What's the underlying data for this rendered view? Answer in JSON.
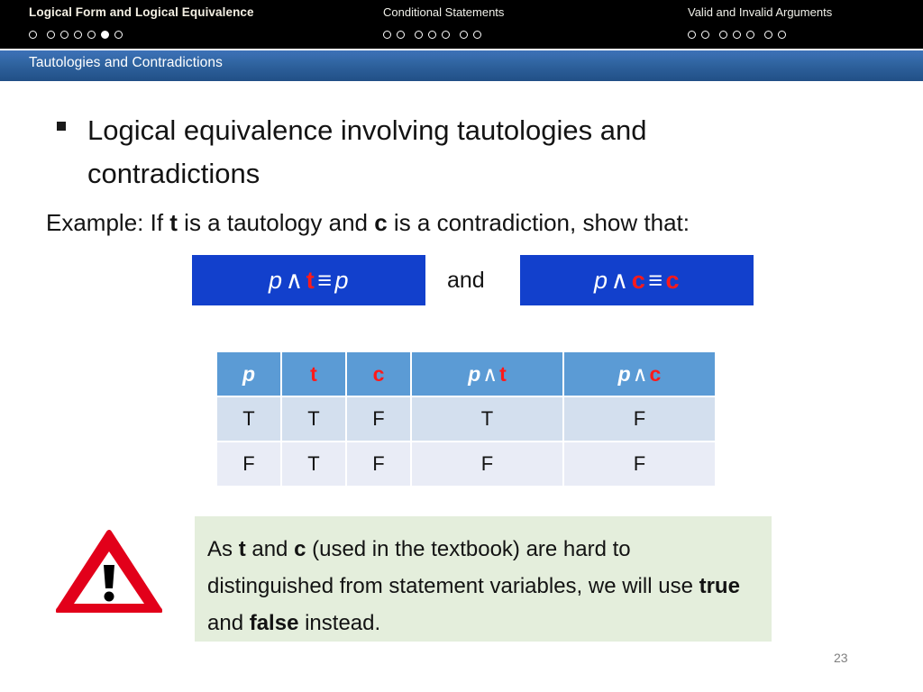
{
  "topbar": {
    "groups": [
      {
        "title": "Logical Form and Logical Equivalence",
        "dots": [
          {
            "state": "empty",
            "gap_after": true
          },
          {
            "state": "empty",
            "gap_after": false
          },
          {
            "state": "empty",
            "gap_after": false
          },
          {
            "state": "empty",
            "gap_after": false
          },
          {
            "state": "empty",
            "gap_after": false
          },
          {
            "state": "filled",
            "gap_after": false
          },
          {
            "state": "empty",
            "gap_after": false
          }
        ]
      },
      {
        "title": "Conditional Statements",
        "dots": [
          {
            "state": "empty",
            "gap_after": false
          },
          {
            "state": "empty",
            "gap_after": true
          },
          {
            "state": "empty",
            "gap_after": false
          },
          {
            "state": "empty",
            "gap_after": false
          },
          {
            "state": "empty",
            "gap_after": true
          },
          {
            "state": "empty",
            "gap_after": false
          },
          {
            "state": "empty",
            "gap_after": false
          }
        ]
      },
      {
        "title": "Valid and Invalid Arguments",
        "dots": [
          {
            "state": "empty",
            "gap_after": false
          },
          {
            "state": "empty",
            "gap_after": true
          },
          {
            "state": "empty",
            "gap_after": false
          },
          {
            "state": "empty",
            "gap_after": false
          },
          {
            "state": "empty",
            "gap_after": true
          },
          {
            "state": "empty",
            "gap_after": false
          },
          {
            "state": "empty",
            "gap_after": false
          }
        ]
      }
    ]
  },
  "section": {
    "label": "Tautologies and Contradictions"
  },
  "slide": {
    "bullet": "Logical equivalence involving tautologies and contradictions",
    "example_prefix": "Example: If ",
    "example_t": "t",
    "example_mid": " is a tautology and ",
    "example_c": "c",
    "example_suffix": " is a contradiction, show that:",
    "and_word": "and",
    "page_number": "23"
  },
  "formulas": [
    {
      "var1": "p",
      "op1": "∧",
      "const": "t",
      "op2": "≡",
      "var2": "p",
      "background": "#1240cc"
    },
    {
      "var1": "p",
      "op1": "∧",
      "const": "c",
      "op2": "≡",
      "var2": "c",
      "background": "#1240cc"
    }
  ],
  "truth_table": {
    "headers": [
      {
        "var": "p",
        "op": "",
        "const": ""
      },
      {
        "var": "",
        "op": "",
        "const": "t"
      },
      {
        "var": "",
        "op": "",
        "const": "c"
      },
      {
        "var": "p",
        "op": "∧",
        "const": "t"
      },
      {
        "var": "p",
        "op": "∧",
        "const": "c"
      }
    ],
    "rows": [
      [
        "T",
        "T",
        "F",
        "T",
        "F"
      ],
      [
        "F",
        "T",
        "F",
        "F",
        "F"
      ]
    ],
    "header_bg": "#5b9bd5",
    "row_bg_a": "#d3dfee",
    "row_bg_b": "#e9ecf6"
  },
  "note": {
    "part1": "As ",
    "bold1": "t",
    "part2": " and ",
    "bold2": "c",
    "part3": " (used in the textbook) are hard to distinguished from statement variables, we will use ",
    "bold3": "true",
    "part4": " and ",
    "bold4": "false",
    "part5": " instead.",
    "background": "#e4eedc"
  },
  "colors": {
    "accent_red": "#ff1a1a",
    "formula_blue": "#1240cc",
    "header_blue": "#5b9bd5",
    "bar_blue": "#2f639f",
    "note_green": "#e4eedc",
    "warn_red": "#e2001a"
  }
}
